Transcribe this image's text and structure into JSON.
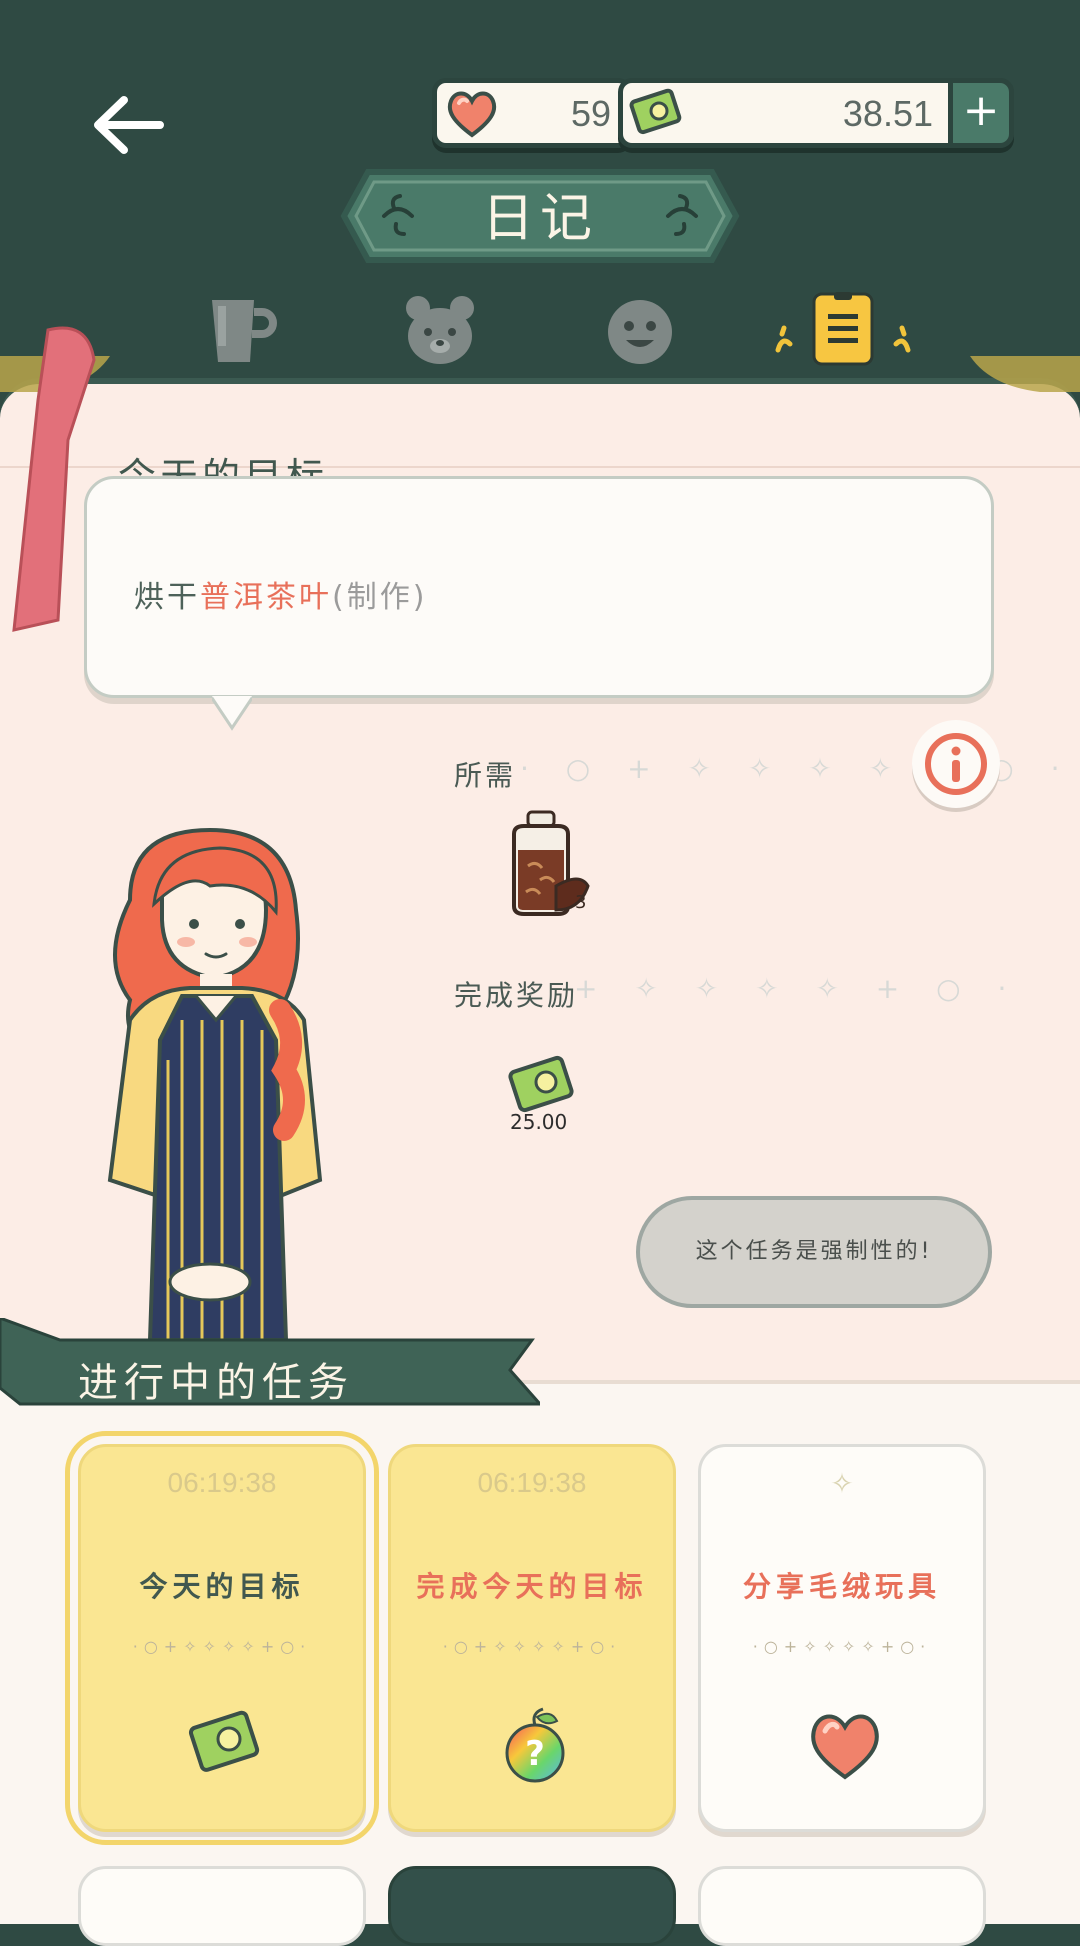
{
  "header": {
    "title": "日记",
    "hearts": "59",
    "money": "38.51",
    "plus_label": "+"
  },
  "tabs": [
    {
      "name": "cup",
      "active": false
    },
    {
      "name": "bear",
      "active": false
    },
    {
      "name": "face",
      "active": false
    },
    {
      "name": "diary",
      "active": true
    }
  ],
  "goal": {
    "header": "今天的目标",
    "prefix": "烘干",
    "highlight": "普洱茶叶",
    "suffix": "(制作)"
  },
  "requirements": {
    "label": "所需",
    "item_icon": "tea-jar-icon",
    "item_count": "3"
  },
  "reward": {
    "label": "完成奖励",
    "icon": "money-icon",
    "amount": "25.00"
  },
  "mandatory_text": "这个任务是强制性的!",
  "tasks": {
    "title": "进行中的任务",
    "cards": [
      {
        "time": "06:19:38",
        "title": "今天的目标",
        "icon": "money-icon",
        "color": "#41584f"
      },
      {
        "time": "06:19:38",
        "title": "完成今天的目标",
        "icon": "mystery-fruit-icon",
        "color": "#e8705a"
      },
      {
        "time": "",
        "title": "分享毛绒玩具",
        "icon": "heart-icon",
        "color": "#e8705a"
      }
    ]
  },
  "colors": {
    "header_bg": "#2f4a43",
    "panel_bg": "#fcede6",
    "accent_coral": "#e8705a",
    "accent_yellow": "#fae692"
  }
}
